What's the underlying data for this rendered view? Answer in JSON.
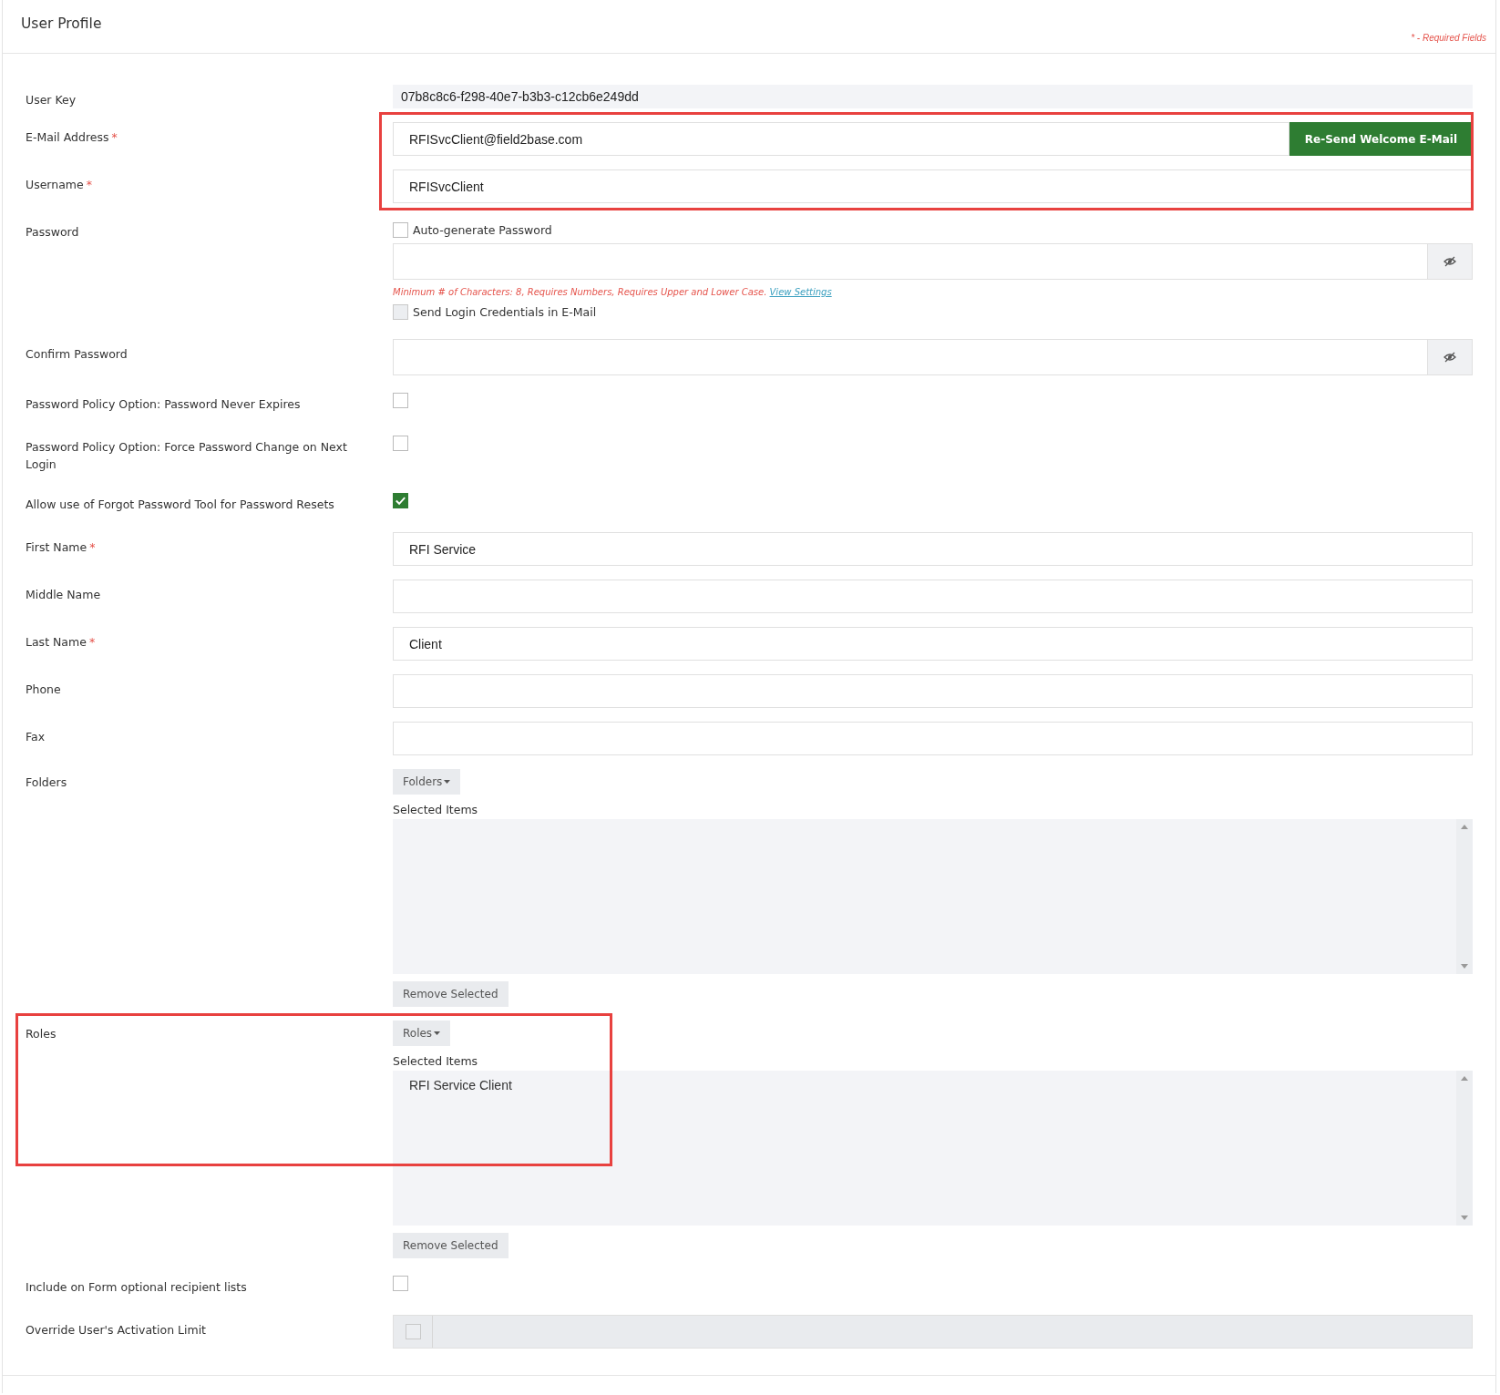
{
  "header": {
    "title": "User Profile",
    "required_note": "* - Required Fields"
  },
  "rows": [
    {
      "kind": "static",
      "label": "User Key",
      "value": "07b8c8c6-f298-40e7-b3b3-c12cb6e249dd",
      "highlighted": false
    },
    {
      "kind": "text",
      "label": "E-Mail Address",
      "required_mark": "*",
      "value": "RFISvcClient@field2base.com",
      "button": "Re-Send Welcome E-Mail",
      "highlighted": true
    },
    {
      "kind": "text",
      "label": "Username",
      "required_mark": "*",
      "value": "RFISvcClient",
      "highlighted": true
    },
    {
      "kind": "password",
      "label": "Password",
      "highlighted": false,
      "auto_generate": {
        "label": "Auto-generate Password",
        "checked": false,
        "disabled": false
      },
      "hint": "Minimum # of Characters: 8, Requires Numbers, Requires Upper and Lower Case.",
      "hint_link": "View Settings",
      "send_credentials": {
        "label": "Send Login Credentials in E-Mail",
        "checked": false,
        "disabled": true
      }
    },
    {
      "kind": "password",
      "label": "Confirm Password",
      "highlighted": false
    },
    {
      "kind": "checkbox",
      "label": "Password Policy Option: Password Never Expires",
      "checked": false,
      "highlighted": false
    },
    {
      "kind": "checkbox",
      "label": "Password Policy Option: Force Password Change on Next Login",
      "checked": false,
      "highlighted": false
    },
    {
      "kind": "checkbox",
      "label": "Allow use of Forgot Password Tool for Password Resets",
      "checked": true,
      "highlighted": false
    },
    {
      "kind": "text",
      "label": "First Name",
      "required_mark": "*",
      "value": "RFI Service",
      "highlighted": false
    },
    {
      "kind": "text",
      "label": "Middle Name",
      "highlighted": false
    },
    {
      "kind": "text",
      "label": "Last Name",
      "required_mark": "*",
      "value": "Client",
      "highlighted": false
    },
    {
      "kind": "text",
      "label": "Phone",
      "highlighted": false
    },
    {
      "kind": "text",
      "label": "Fax",
      "highlighted": false
    },
    {
      "kind": "multiselect",
      "label": "Folders",
      "dropdown": "Folders",
      "list_label": "Selected Items",
      "remove": "Remove Selected",
      "highlighted": false
    },
    {
      "kind": "multiselect",
      "label": "Roles",
      "dropdown": "Roles",
      "list_label": "Selected Items",
      "items": [
        "RFI Service Client"
      ],
      "remove": "Remove Selected",
      "highlighted": true
    },
    {
      "kind": "checkbox",
      "label": "Include on Form optional recipient lists",
      "checked": false,
      "highlighted": false
    },
    {
      "kind": "checkbox-input",
      "label": "Override User's Activation Limit",
      "checked": false,
      "disabled": true,
      "highlighted": false
    }
  ]
}
